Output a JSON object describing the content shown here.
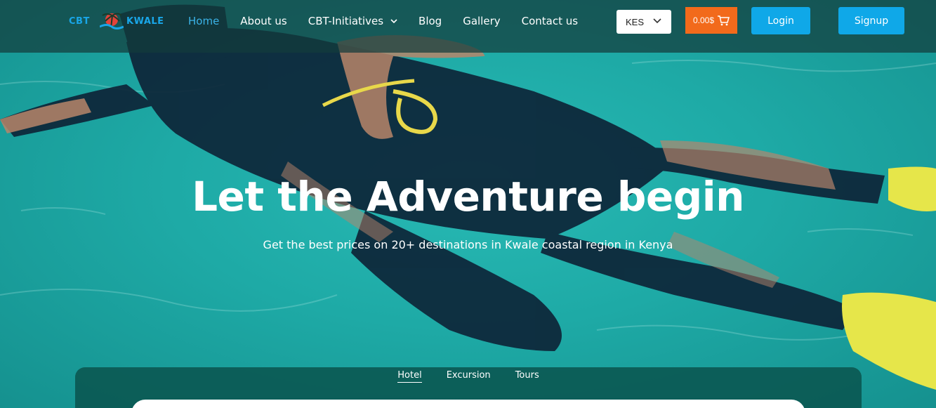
{
  "brand": {
    "logo_left": "CBT",
    "logo_right": "KWALE"
  },
  "nav": {
    "items": [
      {
        "label": "Home",
        "active": true
      },
      {
        "label": "About us"
      },
      {
        "label": "CBT-Initiatives",
        "has_dropdown": true
      },
      {
        "label": "Blog"
      },
      {
        "label": "Gallery"
      },
      {
        "label": "Contact us"
      }
    ]
  },
  "header": {
    "currency": "KES",
    "cart_total": "0.00$",
    "login_label": "Login",
    "signup_label": "Signup"
  },
  "hero": {
    "title": "Let the Adventure begin",
    "subtitle": "Get the best prices on 20+ destinations in Kwale coastal region in Kenya"
  },
  "search": {
    "tabs": [
      {
        "label": "Hotel",
        "active": true
      },
      {
        "label": "Excursion"
      },
      {
        "label": "Tours"
      }
    ]
  },
  "colors": {
    "accent": "#0fa8e8",
    "cart": "#f26a1b",
    "active_nav": "#3bb3e8",
    "water": "#1eaaa6"
  },
  "icons": {
    "cart": "shopping-cart-icon",
    "dropdown": "chevron-down-icon"
  }
}
